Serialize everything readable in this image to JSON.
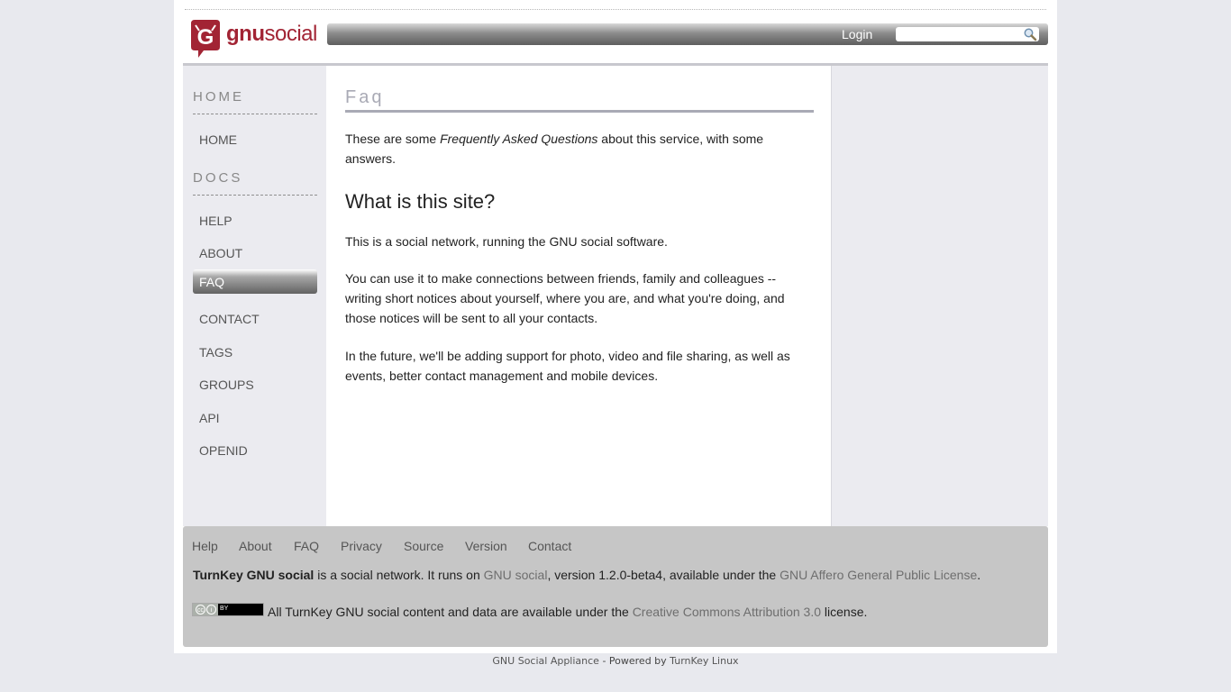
{
  "logo": {
    "word_a": "gnu",
    "word_b": "social"
  },
  "header": {
    "login_label": "Login",
    "search_placeholder": ""
  },
  "sidebar": {
    "sections": [
      {
        "heading": "HOME",
        "items": [
          "HOME"
        ]
      },
      {
        "heading": "DOCS",
        "items": [
          "HELP",
          "ABOUT",
          "FAQ",
          "CONTACT",
          "TAGS",
          "GROUPS",
          "API",
          "OPENID"
        ]
      }
    ],
    "active_item": "FAQ"
  },
  "main": {
    "title": "Faq",
    "intro_a": "These are some ",
    "intro_em": "Frequently Asked Questions",
    "intro_b": " about this service, with some answers.",
    "heading": "What is this site?",
    "paragraphs": [
      "This is a social network, running the GNU social software.",
      "You can use it to make connections between friends, family and colleagues -- writing short notices about yourself, where you are, and what you're doing, and those notices will be sent to all your contacts.",
      "In the future, we'll be adding support for photo, video and file sharing, as well as events, better contact management and mobile devices."
    ]
  },
  "footer": {
    "links": [
      "Help",
      "About",
      "FAQ",
      "Privacy",
      "Source",
      "Version",
      "Contact"
    ],
    "line1": {
      "site": "TurnKey GNU social",
      "t1": " is a social network. It runs on ",
      "link1": "GNU social",
      "t2": ", version 1.2.0-beta4, available under the ",
      "link2": "GNU Affero General Public License",
      "t3": "."
    },
    "line2": {
      "t1": "All TurnKey GNU social content and data are available under the ",
      "link": "Creative Commons Attribution 3.0",
      "t2": " license."
    },
    "cc_by": "BY"
  },
  "appliance": {
    "name": "GNU Social Appliance",
    "sep": " - Powered by ",
    "link": "TurnKey Linux"
  },
  "colors": {
    "brand": "#a22434",
    "title_grey": "#a9aab5",
    "footer_bg": "#c6c6c6",
    "page_bg": "#e8e9ee"
  }
}
